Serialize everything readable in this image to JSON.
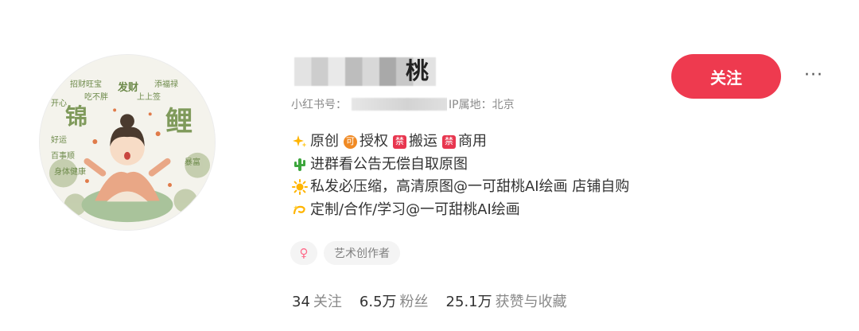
{
  "profile": {
    "username_visible": "桃",
    "redbook_label": "小红书号：",
    "ip_location": "IP属地：北京"
  },
  "avatar": {
    "big_chars": [
      "锦",
      "鲤"
    ],
    "small_chars": [
      "招财旺宝",
      "发财",
      "添福禄",
      "开心",
      "吃不胖",
      "上上签",
      "好运",
      "暴富",
      "百事顺",
      "身体健康"
    ]
  },
  "bio": [
    {
      "icon": "sparkles-icon",
      "parts": [
        {
          "type": "text",
          "text": "原创"
        },
        {
          "type": "chip",
          "text": "可",
          "color": "#f08a24"
        },
        {
          "type": "text",
          "text": "授权"
        },
        {
          "type": "chip",
          "text": "禁",
          "color": "#e8364f"
        },
        {
          "type": "text",
          "text": "搬运"
        },
        {
          "type": "chip",
          "text": "禁",
          "color": "#e8364f"
        },
        {
          "type": "text",
          "text": "商用"
        }
      ]
    },
    {
      "icon": "cactus-icon",
      "text": "进群看公告无偿自取原图"
    },
    {
      "icon": "sun-icon",
      "text": "私发必压缩，高清原图@一可甜桃AI绘画 店铺自购"
    },
    {
      "icon": "dizzy-icon",
      "text": "定制/合作/学习@一可甜桃AI绘画"
    }
  ],
  "tags": {
    "gender_symbol": "♀",
    "job": "艺术创作者"
  },
  "stats": [
    {
      "value": "34",
      "label": "关注"
    },
    {
      "value": "6.5万",
      "label": "粉丝"
    },
    {
      "value": "25.1万",
      "label": "获赞与收藏"
    }
  ],
  "actions": {
    "follow_label": "关注",
    "more_label": "···"
  },
  "colors": {
    "follow_button": "#ee3a4f",
    "chip_orange": "#f08a24",
    "chip_red": "#e8364f"
  }
}
